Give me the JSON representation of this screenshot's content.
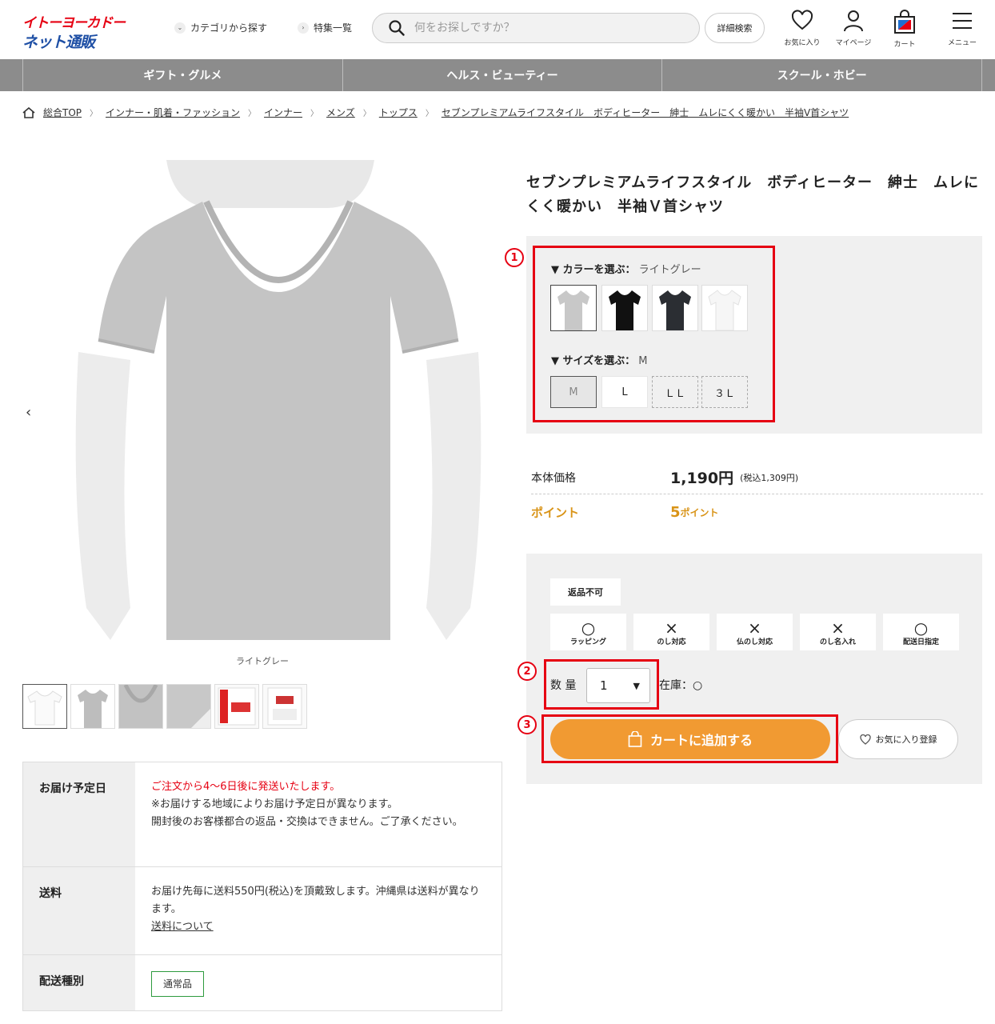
{
  "header": {
    "logo_line1": "イトーヨーカドー",
    "logo_line2": "ネット通販",
    "category_link": "カテゴリから探す",
    "feature_link": "特集一覧",
    "search_placeholder": "何をお探しですか？",
    "advanced_search": "詳細検索",
    "favorites": "お気に入り",
    "mypage": "マイページ",
    "cart": "カート",
    "menu": "メニュー"
  },
  "nav": [
    "ギフト・グルメ",
    "ヘルス・ビューティー",
    "スクール・ホビー"
  ],
  "breadcrumb": [
    "総合TOP",
    "インナー・肌着・ファッション",
    "インナー",
    "メンズ",
    "トップス",
    "セブンプレミアムライフスタイル　ボディヒーター　紳士　ムレにくく暖かい　半袖V首シャツ"
  ],
  "gallery": {
    "caption": "ライトグレー",
    "thumb_icons": [
      "tshirt-white-icon",
      "tshirt-gray-model-icon",
      "collar-closeup-icon",
      "sleeve-closeup-icon",
      "package-front-icon",
      "package-back-icon"
    ]
  },
  "info": {
    "delivery_label": "お届け予定日",
    "delivery_line1": "ご注文から4～6日後に発送いたします。",
    "delivery_line2": "※お届けする地域によりお届け予定日が異なります。",
    "delivery_line3": "開封後のお客様都合の返品・交換はできません。ご了承ください。",
    "shipping_label": "送料",
    "shipping_text": "お届け先毎に送料550円(税込)を頂戴致します。沖縄県は送料が異なります。",
    "shipping_link": "送料について",
    "type_label": "配送種別",
    "type_value": "通常品"
  },
  "product": {
    "title": "セブンプレミアムライフスタイル　ボディヒーター　紳士　ムレにくく暖かい　半袖Ｖ首シャツ",
    "color_label": "▼ カラーを選ぶ：",
    "color_selected": "ライトグレー",
    "colors": [
      "#c8c8c8",
      "#111111",
      "#2b2e33",
      "#f6f6f6"
    ],
    "size_label": "▼ サイズを選ぶ：",
    "size_selected": "M",
    "sizes": [
      "M",
      "L",
      "ＬＬ",
      "３Ｌ"
    ],
    "price_label": "本体価格",
    "price": "1,190円",
    "price_tax": "(税込1,309円)",
    "point_label": "ポイント",
    "point_value": "5",
    "point_unit": "ポイント",
    "return_badge": "返品不可",
    "options": [
      {
        "symbol": "○",
        "label": "ラッピング"
      },
      {
        "symbol": "×",
        "label": "のし対応"
      },
      {
        "symbol": "×",
        "label": "仏のし対応"
      },
      {
        "symbol": "×",
        "label": "のし名入れ"
      },
      {
        "symbol": "○",
        "label": "配送日指定"
      }
    ],
    "qty_label": "数 量",
    "qty_value": "1",
    "stock_label": "在庫：○",
    "add_to_cart": "カートに追加する",
    "add_favorite": "お気に入り登録"
  },
  "annotations": [
    "1",
    "2",
    "3"
  ],
  "colors": {
    "accent_orange": "#f19a32",
    "highlight_red": "#e60012",
    "point_gold": "#d99418",
    "nav_gray": "#8c8c8c"
  }
}
